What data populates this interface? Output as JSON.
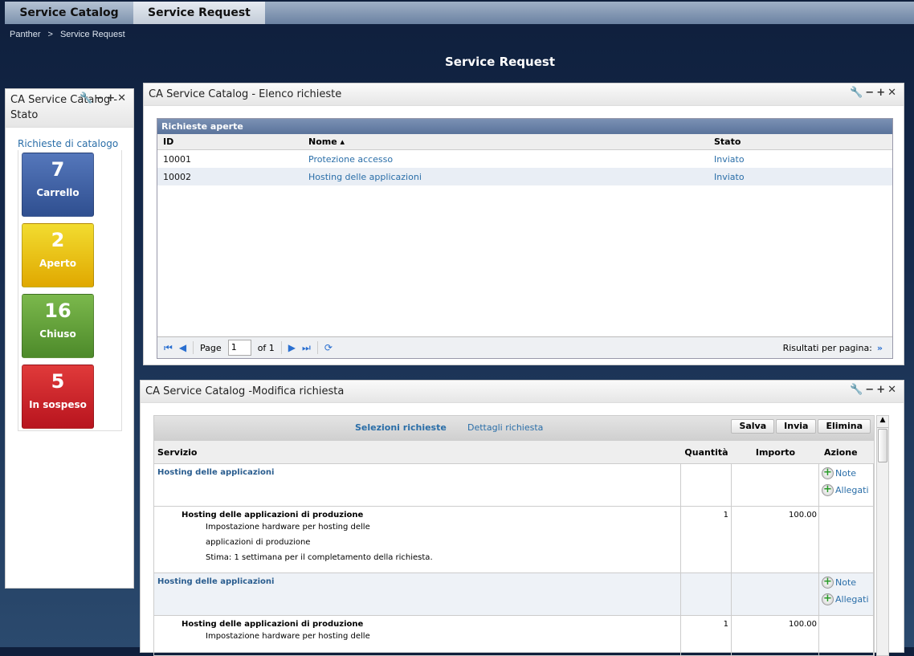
{
  "tabs": [
    "Service Catalog",
    "Service Request"
  ],
  "breadcrumb": [
    "Panther",
    ">",
    "Service Request"
  ],
  "page_title": "Service Request",
  "status_panel": {
    "title": "CA Service Catalog - Stato",
    "link": "Richieste di catalogo",
    "tiles": [
      {
        "count": "7",
        "label": "Carrello",
        "color": "#3a5aa0"
      },
      {
        "count": "2",
        "label": "Aperto",
        "color": "#e0b800"
      },
      {
        "count": "16",
        "label": "Chiuso",
        "color": "#5e9a36"
      },
      {
        "count": "5",
        "label": "In sospeso",
        "color": "#c8202a"
      }
    ]
  },
  "list_panel": {
    "title": "CA Service Catalog - Elenco richieste",
    "grid_title": "Richieste aperte",
    "columns": [
      "ID",
      "Nome ▴",
      "Stato"
    ],
    "rows": [
      {
        "id": "10001",
        "name": "Protezione accesso",
        "status": "Inviato"
      },
      {
        "id": "10002",
        "name": "Hosting delle applicazioni",
        "status": "Inviato"
      }
    ],
    "pager": {
      "page_label": "Page",
      "page": "1",
      "of": "of 1",
      "per_page": "Risultati per pagina:"
    }
  },
  "edit_panel": {
    "title": "CA Service Catalog -Modifica richiesta",
    "tabs": [
      "Selezioni richieste",
      "Dettagli richiesta"
    ],
    "buttons": [
      "Salva",
      "Invia",
      "Elimina"
    ],
    "columns": [
      "Servizio",
      "Quantità",
      "Importo",
      "Azione"
    ],
    "actions": [
      "Note",
      "Allegati"
    ],
    "groups": [
      {
        "service": "Hosting delle applicazioni",
        "item": "Hosting delle applicazioni di produzione",
        "qty": "1",
        "amount": "100.00",
        "desc1": "Impostazione hardware per hosting delle",
        "desc2": "applicazioni di produzione",
        "estimate": "Stima: 1 settimana per il completamento della richiesta."
      },
      {
        "service": "Hosting delle applicazioni",
        "item": "Hosting delle applicazioni di produzione",
        "qty": "1",
        "amount": "100.00",
        "desc1": "Impostazione hardware per hosting delle"
      }
    ]
  }
}
